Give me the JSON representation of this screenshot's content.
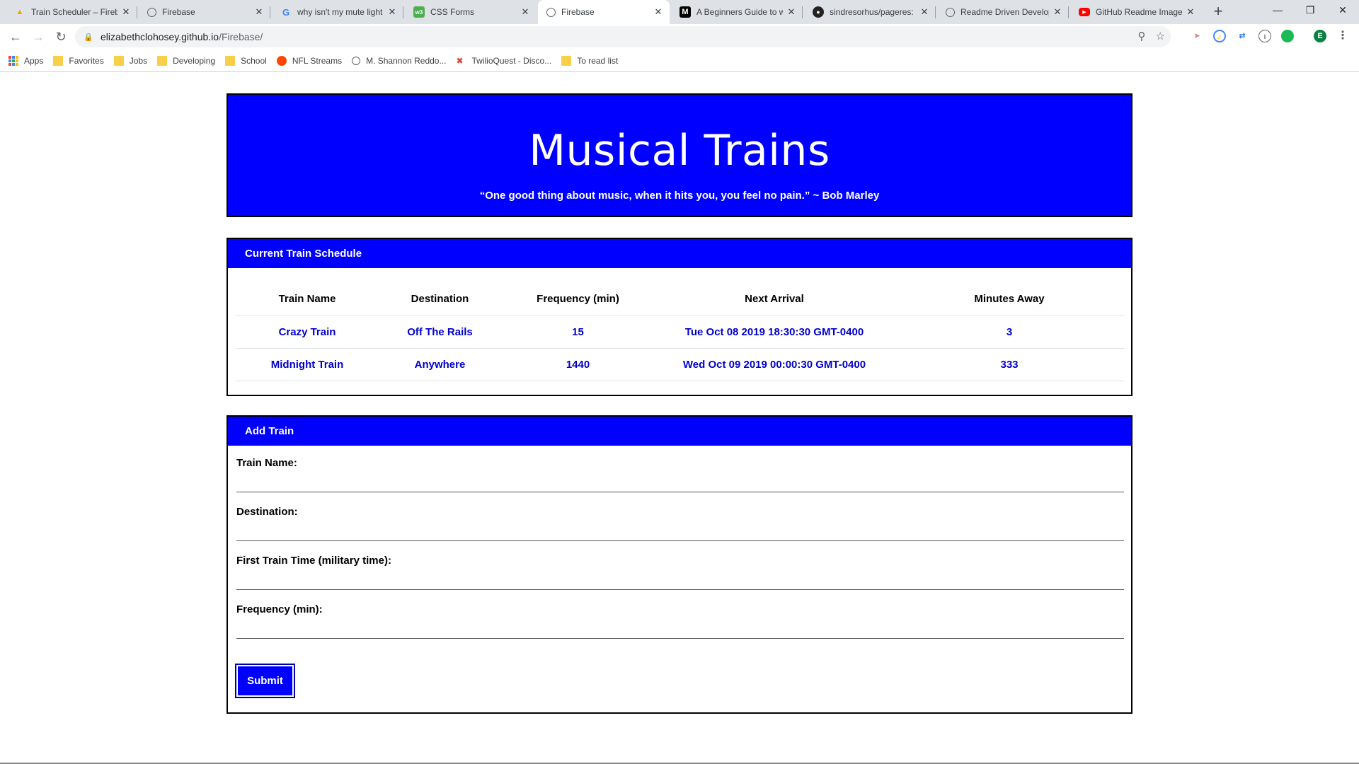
{
  "browser": {
    "tabs": [
      {
        "title": "Train Scheduler – Firebase",
        "icon": "firebase-icon",
        "active": false
      },
      {
        "title": "Firebase",
        "icon": "globe-icon",
        "active": false
      },
      {
        "title": "why isn't my mute light",
        "icon": "google-icon",
        "active": false
      },
      {
        "title": "CSS Forms",
        "icon": "w3schools-icon",
        "active": false
      },
      {
        "title": "Firebase",
        "icon": "globe-icon",
        "active": true
      },
      {
        "title": "A Beginners Guide to w",
        "icon": "medium-icon",
        "active": false
      },
      {
        "title": "sindresorhus/pageres:",
        "icon": "github-icon",
        "active": false
      },
      {
        "title": "Readme Driven Develop",
        "icon": "globe-icon",
        "active": false
      },
      {
        "title": "GitHub Readme Images",
        "icon": "youtube-icon",
        "active": false
      }
    ],
    "url_host": "elizabethclohosey.github.io",
    "url_path": "/Firebase/",
    "profile_initial": "E",
    "bookmarks": [
      {
        "label": "Apps",
        "icon": "apps-grid-icon"
      },
      {
        "label": "Favorites",
        "icon": "folder-icon"
      },
      {
        "label": "Jobs",
        "icon": "folder-icon"
      },
      {
        "label": "Developing",
        "icon": "folder-icon"
      },
      {
        "label": "School",
        "icon": "folder-icon"
      },
      {
        "label": "NFL Streams",
        "icon": "reddit-icon"
      },
      {
        "label": "M. Shannon Reddo...",
        "icon": "globe-icon"
      },
      {
        "label": "TwilioQuest - Disco...",
        "icon": "twilio-icon"
      },
      {
        "label": "To read list",
        "icon": "folder-icon"
      }
    ]
  },
  "header": {
    "title": "Musical Trains",
    "quote": "“One good thing about music, when it hits you, you feel no pain.” ~ Bob Marley"
  },
  "schedule": {
    "heading": "Current Train Schedule",
    "columns": [
      "Train Name",
      "Destination",
      "Frequency (min)",
      "Next Arrival",
      "Minutes Away"
    ],
    "rows": [
      [
        "Crazy Train",
        "Off The Rails",
        "15",
        "Tue Oct 08 2019 18:30:30 GMT-0400",
        "3"
      ],
      [
        "Midnight Train",
        "Anywhere",
        "1440",
        "Wed Oct 09 2019 00:00:30 GMT-0400",
        "333"
      ]
    ]
  },
  "add_train": {
    "heading": "Add Train",
    "fields": [
      {
        "label": "Train Name:",
        "value": ""
      },
      {
        "label": "Destination:",
        "value": ""
      },
      {
        "label": "First Train Time (military time):",
        "value": ""
      },
      {
        "label": "Frequency (min):",
        "value": ""
      }
    ],
    "submit_label": "Submit"
  },
  "colors": {
    "accent": "#0000ff",
    "table_text": "#0000cc"
  }
}
